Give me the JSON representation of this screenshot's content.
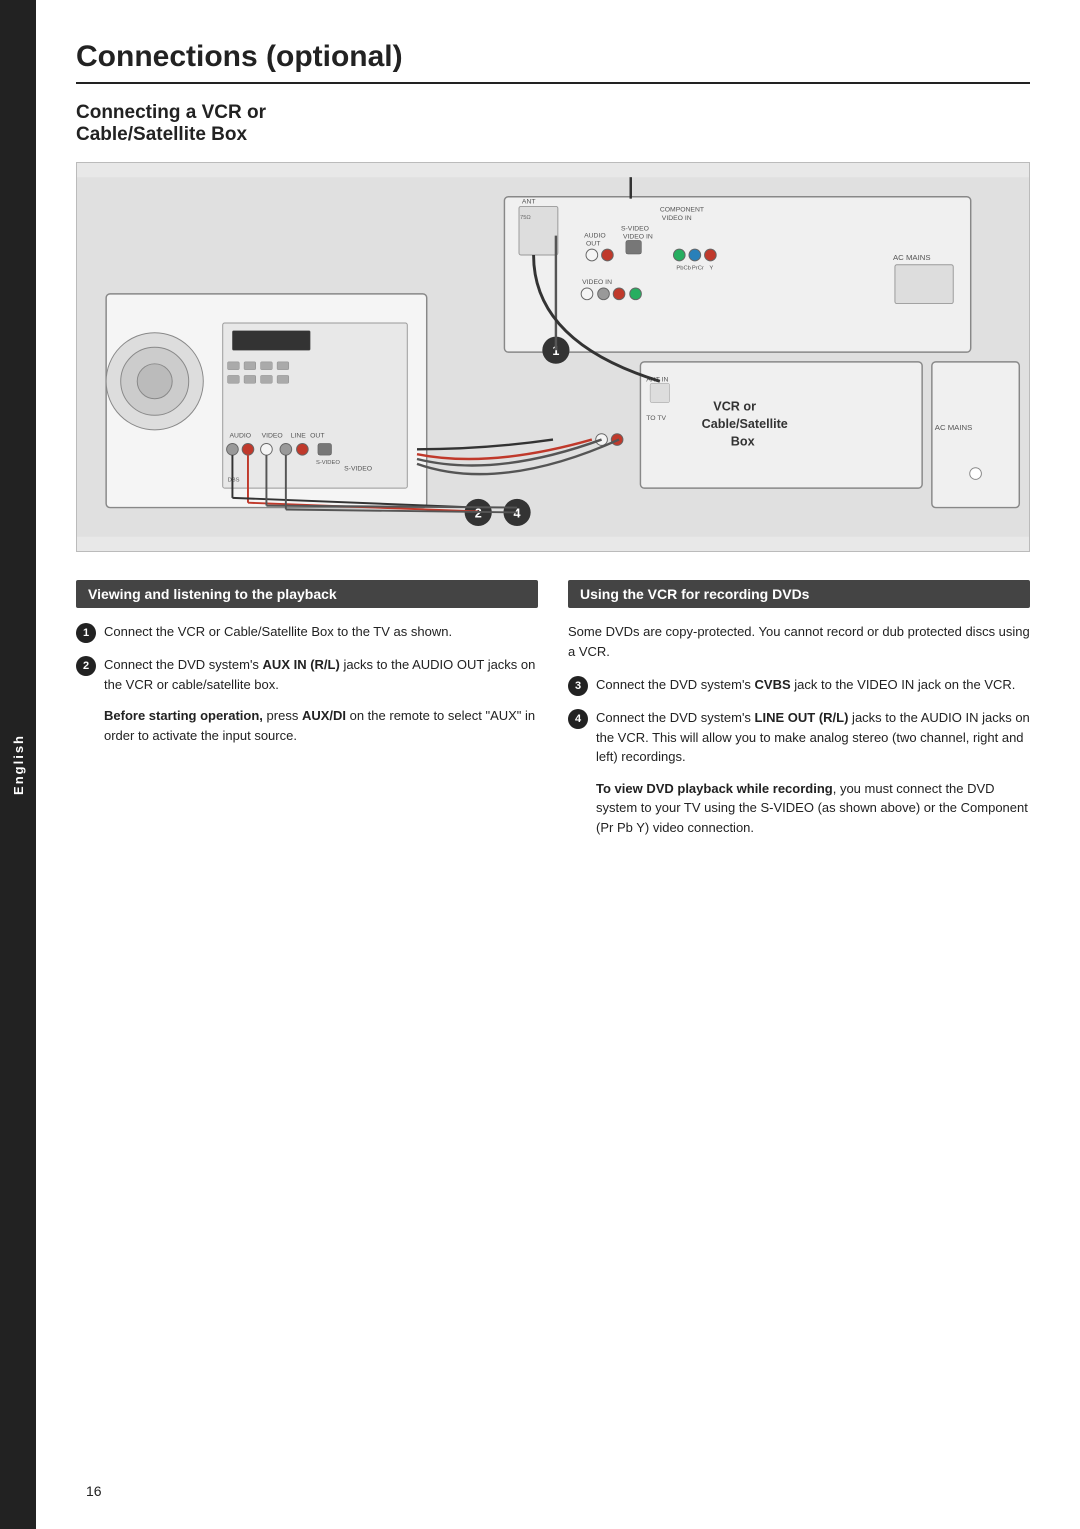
{
  "sidebar": {
    "label": "English"
  },
  "page": {
    "title": "Connections (optional)",
    "section_title_line1": "Connecting a VCR or",
    "section_title_line2": "Cable/Satellite Box",
    "diagram_label": "VCR or Cable/Satellite Box",
    "left_section": {
      "header": "Viewing and listening to the playback",
      "steps": [
        {
          "number": "1",
          "text": "Connect the VCR or Cable/Satellite Box to the TV as shown."
        },
        {
          "number": "2",
          "text_before": "Connect the DVD system's ",
          "bold": "AUX IN (R/L)",
          "text_after": " jacks to the AUDIO OUT jacks on the VCR or cable/satellite box."
        }
      ],
      "note": {
        "bold_start": "Before starting operation,",
        "text": " press ",
        "bold_mid": "AUX/DI",
        "text2": " on the remote to select \"AUX\" in order to activate the input source."
      }
    },
    "right_section": {
      "header": "Using the VCR for recording DVDs",
      "intro": "Some DVDs are copy-protected. You cannot record or dub protected discs using a VCR.",
      "steps": [
        {
          "number": "3",
          "text_before": "Connect the DVD system's ",
          "bold": "CVBS",
          "text_after": " jack to the VIDEO IN jack on the VCR."
        },
        {
          "number": "4",
          "text_before": "Connect the DVD system's ",
          "bold": "LINE OUT (R/L)",
          "text_after": " jacks to the AUDIO IN jacks on the VCR. This will allow you to make analog stereo (two channel, right and left) recordings."
        }
      ],
      "note": {
        "bold_start": "To view DVD playback while recording",
        "text": ", you must connect the DVD system to your TV using the S-VIDEO (as shown above) or the Component (Pr Pb Y) video connection."
      }
    },
    "page_number": "16"
  }
}
